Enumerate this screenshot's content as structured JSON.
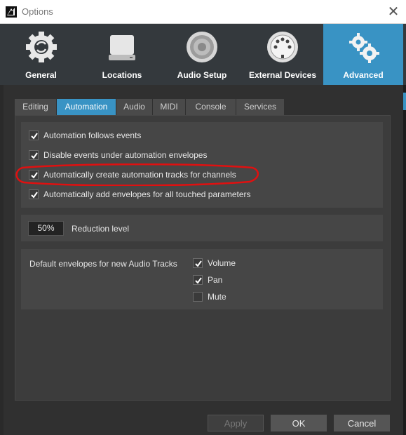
{
  "window": {
    "title": "Options"
  },
  "categories": [
    {
      "label": "General",
      "icon": "gear-refresh-icon"
    },
    {
      "label": "Locations",
      "icon": "drive-icon"
    },
    {
      "label": "Audio Setup",
      "icon": "speaker-icon"
    },
    {
      "label": "External Devices",
      "icon": "midi-connector-icon"
    },
    {
      "label": "Advanced",
      "icon": "gears-icon",
      "active": true
    }
  ],
  "tabs": [
    {
      "label": "Editing"
    },
    {
      "label": "Automation",
      "active": true
    },
    {
      "label": "Audio"
    },
    {
      "label": "MIDI"
    },
    {
      "label": "Console"
    },
    {
      "label": "Services"
    }
  ],
  "automation_options": [
    {
      "label": "Automation follows events",
      "checked": true
    },
    {
      "label": "Disable events under automation envelopes",
      "checked": true
    },
    {
      "label": "Automatically create automation tracks for channels",
      "checked": true,
      "highlighted": true
    },
    {
      "label": "Automatically add envelopes for all touched parameters",
      "checked": true
    }
  ],
  "reduction": {
    "value": "50%",
    "label": "Reduction level"
  },
  "default_envelopes": {
    "label": "Default envelopes for new Audio Tracks",
    "options": [
      {
        "label": "Volume",
        "checked": true
      },
      {
        "label": "Pan",
        "checked": true
      },
      {
        "label": "Mute",
        "checked": false
      }
    ]
  },
  "buttons": {
    "apply": "Apply",
    "ok": "OK",
    "cancel": "Cancel"
  },
  "colors": {
    "accent": "#3993c4",
    "highlight_ring": "#e01010"
  }
}
